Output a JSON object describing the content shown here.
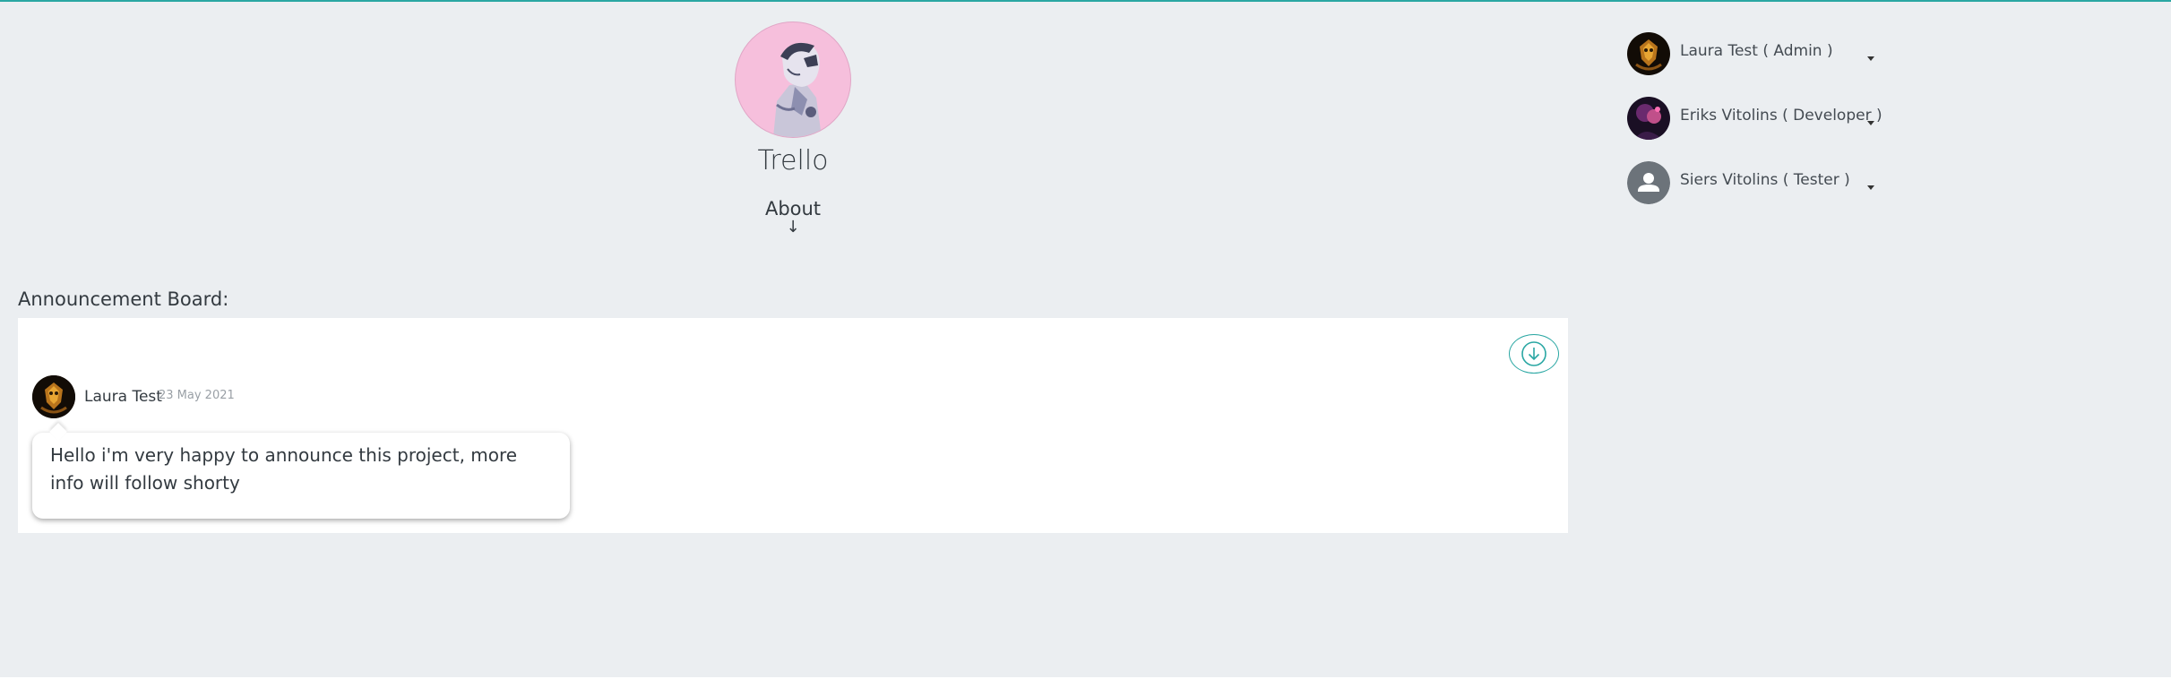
{
  "project": {
    "title": "Trello",
    "about_label": "About",
    "about_arrow": "↓"
  },
  "board": {
    "label": "Announcement Board:",
    "posts": [
      {
        "author": "Laura Test",
        "date": "23 May 2021",
        "text": "Hello i'm very happy to announce this project, more info will follow shorty"
      }
    ]
  },
  "members": [
    {
      "name": "Laura Test ( Admin )",
      "avatar": "avatar-image"
    },
    {
      "name": "Eriks Vitolins ( Developer )",
      "avatar": "avatar-image"
    },
    {
      "name": "Siers Vitolins ( Tester )",
      "avatar": "person-placeholder-icon"
    }
  ],
  "colors": {
    "accent": "#2aa7a3",
    "background": "#ebeef1",
    "panel": "#ffffff",
    "project_avatar_bg": "#f6bfdc"
  },
  "icons": {
    "scroll_button": "arrow-down-circle-icon",
    "member_menu": "caret-down-icon"
  }
}
